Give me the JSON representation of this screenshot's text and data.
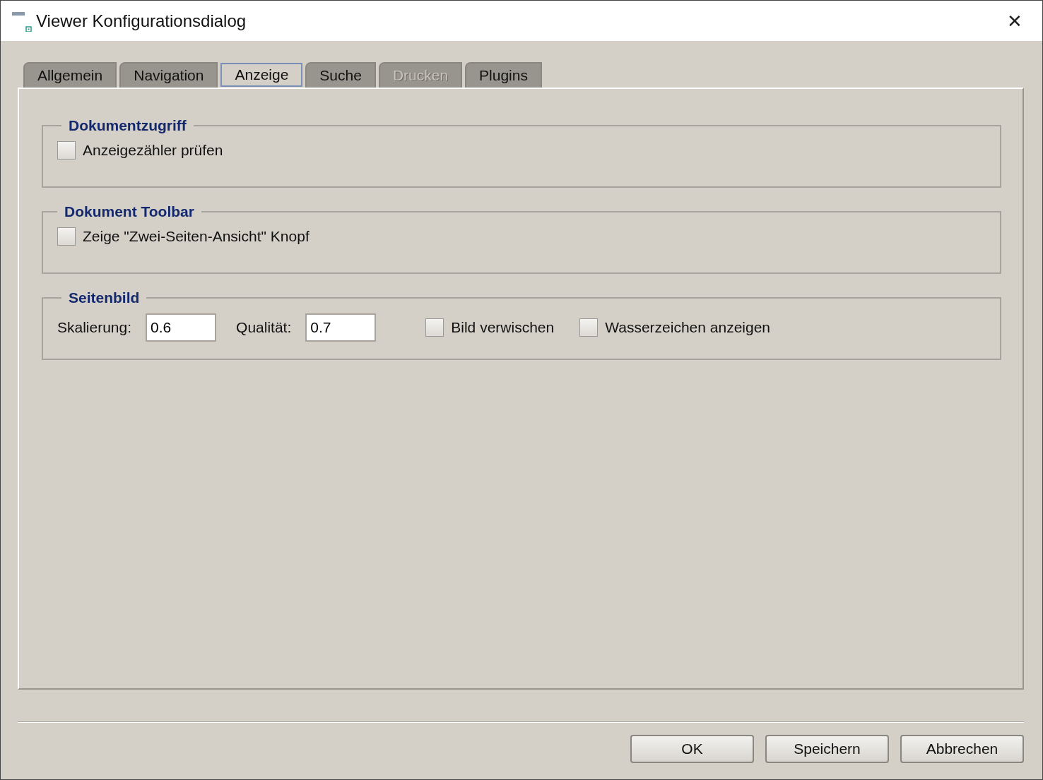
{
  "window": {
    "title": "Viewer Konfigurationsdialog",
    "close": "✕"
  },
  "tabs": [
    {
      "label": "Allgemein",
      "selected": false,
      "disabled": false
    },
    {
      "label": "Navigation",
      "selected": false,
      "disabled": false
    },
    {
      "label": "Anzeige",
      "selected": true,
      "disabled": false
    },
    {
      "label": "Suche",
      "selected": false,
      "disabled": false
    },
    {
      "label": "Drucken",
      "selected": false,
      "disabled": true
    },
    {
      "label": "Plugins",
      "selected": false,
      "disabled": false
    }
  ],
  "groups": [
    {
      "title": "Dokumentzugriff",
      "items": [
        {
          "kind": "checkbox",
          "label": "Anzeigezähler prüfen",
          "checked": false
        }
      ]
    },
    {
      "title": "Dokument Toolbar",
      "items": [
        {
          "kind": "checkbox",
          "label": "Zeige \"Zwei-Seiten-Ansicht\" Knopf",
          "checked": false
        }
      ]
    },
    {
      "title": "Seitenbild",
      "items": [
        {
          "kind": "field",
          "label": "Skalierung:",
          "value": "0.6"
        },
        {
          "kind": "field",
          "label": "Qualität:",
          "value": "0.7"
        },
        {
          "kind": "checkbox",
          "label": "Bild verwischen",
          "checked": false
        },
        {
          "kind": "checkbox",
          "label": "Wasserzeichen anzeigen",
          "checked": false
        }
      ]
    }
  ],
  "buttons": [
    "OK",
    "Speichern",
    "Abbrechen"
  ]
}
